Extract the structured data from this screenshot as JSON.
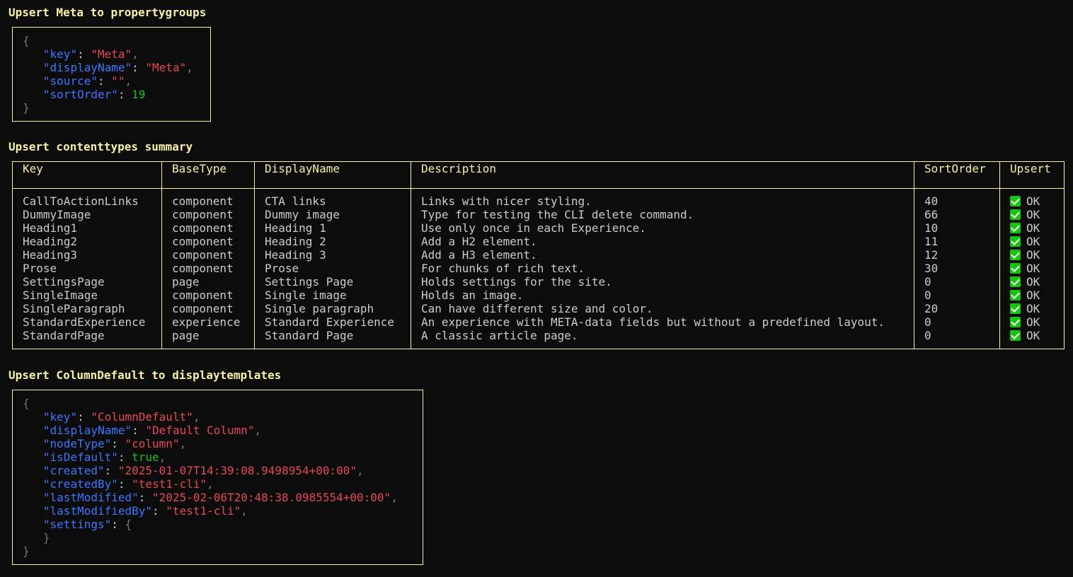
{
  "section1": {
    "title": "Upsert Meta to propertygroups",
    "json": {
      "open": "{",
      "close": "}",
      "key_key": "\"key\"",
      "key_val": "\"Meta\"",
      "displayName_key": "\"displayName\"",
      "displayName_val": "\"Meta\"",
      "source_key": "\"source\"",
      "source_val": "\"\"",
      "sortOrder_key": "\"sortOrder\"",
      "sortOrder_val": "19"
    }
  },
  "section2": {
    "title": "Upsert contenttypes summary",
    "columns": [
      "Key",
      "BaseType",
      "DisplayName",
      "Description",
      "SortOrder",
      "Upsert"
    ],
    "rows": [
      {
        "key": "CallToActionLinks",
        "baseType": "component",
        "displayName": "CTA links",
        "description": "Links with nicer styling.",
        "sortOrder": "40",
        "upsert": "OK"
      },
      {
        "key": "DummyImage",
        "baseType": "component",
        "displayName": "Dummy image",
        "description": "Type for testing the CLI delete command.",
        "sortOrder": "66",
        "upsert": "OK"
      },
      {
        "key": "Heading1",
        "baseType": "component",
        "displayName": "Heading 1",
        "description": "Use only once in each Experience.",
        "sortOrder": "10",
        "upsert": "OK"
      },
      {
        "key": "Heading2",
        "baseType": "component",
        "displayName": "Heading 2",
        "description": "Add a H2 element.",
        "sortOrder": "11",
        "upsert": "OK"
      },
      {
        "key": "Heading3",
        "baseType": "component",
        "displayName": "Heading 3",
        "description": "Add a H3 element.",
        "sortOrder": "12",
        "upsert": "OK"
      },
      {
        "key": "Prose",
        "baseType": "component",
        "displayName": "Prose",
        "description": "For chunks of rich text.",
        "sortOrder": "30",
        "upsert": "OK"
      },
      {
        "key": "SettingsPage",
        "baseType": "page",
        "displayName": "Settings Page",
        "description": "Holds settings for the site.",
        "sortOrder": "0",
        "upsert": "OK"
      },
      {
        "key": "SingleImage",
        "baseType": "component",
        "displayName": "Single image",
        "description": "Holds an image.",
        "sortOrder": "0",
        "upsert": "OK"
      },
      {
        "key": "SingleParagraph",
        "baseType": "component",
        "displayName": "Single paragraph",
        "description": "Can have different size and color.",
        "sortOrder": "20",
        "upsert": "OK"
      },
      {
        "key": "StandardExperience",
        "baseType": "experience",
        "displayName": "Standard Experience",
        "description": "An experience with META-data fields but without a predefined layout.",
        "sortOrder": "0",
        "upsert": "OK"
      },
      {
        "key": "StandardPage",
        "baseType": "page",
        "displayName": "Standard Page",
        "description": "A classic article page.",
        "sortOrder": "0",
        "upsert": "OK"
      }
    ]
  },
  "section3": {
    "title": "Upsert ColumnDefault to displaytemplates",
    "json": {
      "open": "{",
      "close": "}",
      "key_key": "\"key\"",
      "key_val": "\"ColumnDefault\"",
      "displayName_key": "\"displayName\"",
      "displayName_val": "\"Default Column\"",
      "nodeType_key": "\"nodeType\"",
      "nodeType_val": "\"column\"",
      "isDefault_key": "\"isDefault\"",
      "isDefault_val": "true",
      "created_key": "\"created\"",
      "created_val": "\"2025-01-07T14:39:08.9498954+00:00\"",
      "createdBy_key": "\"createdBy\"",
      "createdBy_val": "\"test1-cli\"",
      "lastModified_key": "\"lastModified\"",
      "lastModified_val": "\"2025-02-06T20:48:38.0985554+00:00\"",
      "lastModifiedBy_key": "\"lastModifiedBy\"",
      "lastModifiedBy_val": "\"test1-cli\"",
      "settings_key": "\"settings\"",
      "settings_open": "{",
      "settings_close": "}"
    }
  },
  "colors": {
    "heading": "#f9f1a5",
    "json_key": "#3b78ff",
    "json_string": "#e74856",
    "json_number": "#16c60c",
    "check": "#16c60c",
    "background": "#0c0c0c"
  },
  "icons": {
    "upsert_status": "green-check-icon"
  }
}
